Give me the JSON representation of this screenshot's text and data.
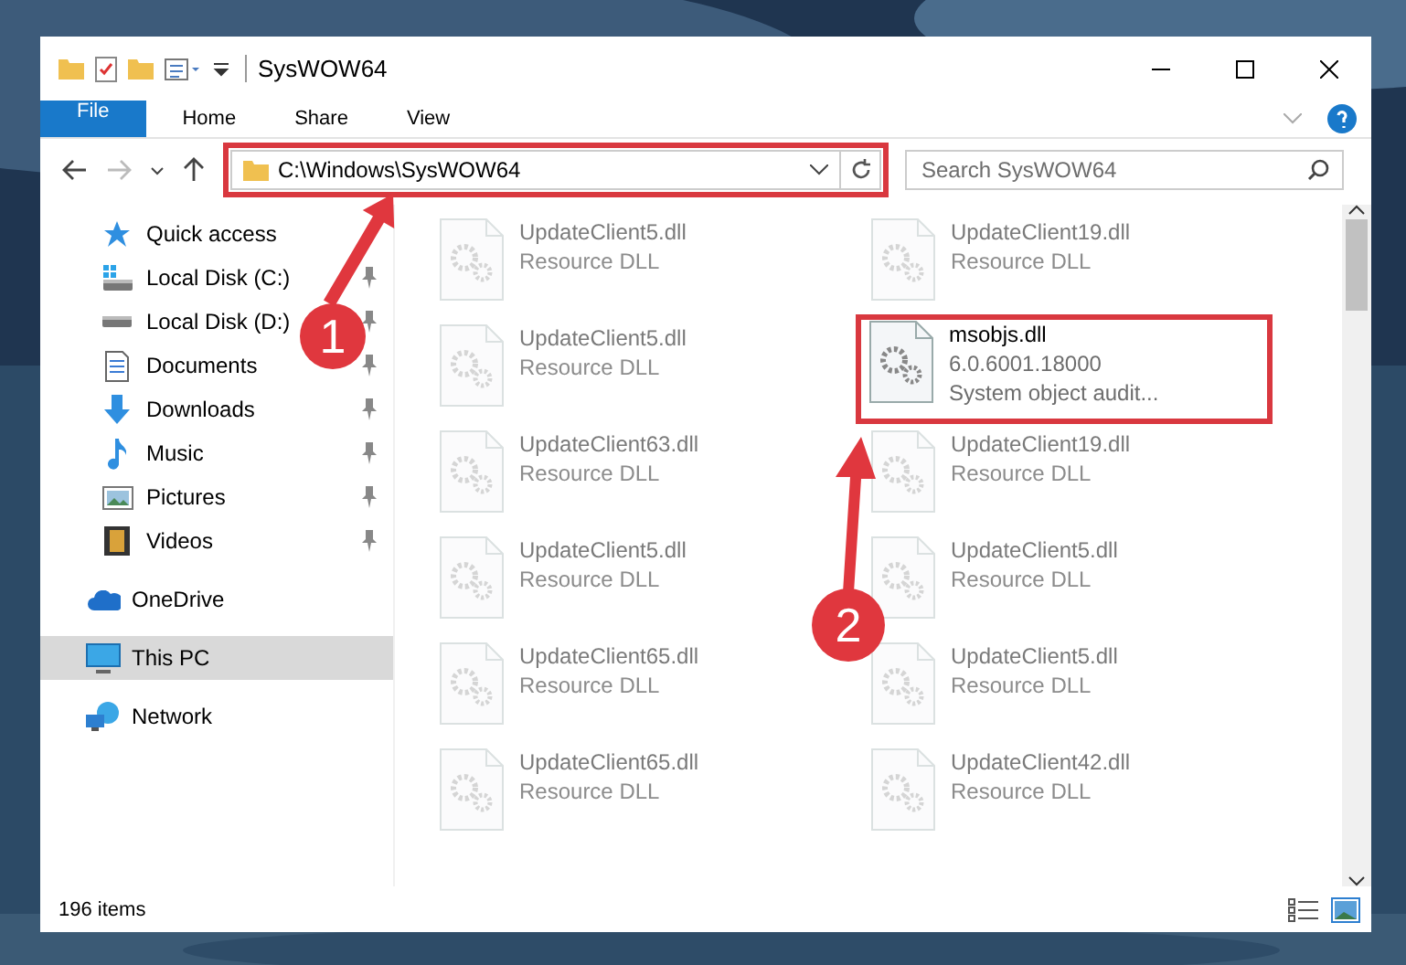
{
  "window": {
    "title": "SysWOW64"
  },
  "ribbon_tabs": [
    {
      "label": "File",
      "kind": "file"
    },
    {
      "label": "Home",
      "kind": "tab"
    },
    {
      "label": "Share",
      "kind": "tab"
    },
    {
      "label": "View",
      "kind": "tab"
    }
  ],
  "address_bar": {
    "path": "C:\\Windows\\SysWOW64"
  },
  "search": {
    "placeholder": "Search SysWOW64"
  },
  "sidebar": {
    "items": [
      {
        "label": "Quick access",
        "kind": "star",
        "pinned": false,
        "selected": false
      },
      {
        "label": "Local Disk (C:)",
        "kind": "drive-win",
        "pinned": true,
        "selected": false
      },
      {
        "label": "Local Disk (D:)",
        "kind": "drive",
        "pinned": true,
        "selected": false
      },
      {
        "label": "Documents",
        "kind": "doc",
        "pinned": true,
        "selected": false
      },
      {
        "label": "Downloads",
        "kind": "download",
        "pinned": true,
        "selected": false
      },
      {
        "label": "Music",
        "kind": "music",
        "pinned": true,
        "selected": false
      },
      {
        "label": "Pictures",
        "kind": "pictures",
        "pinned": true,
        "selected": false
      },
      {
        "label": "Videos",
        "kind": "videos",
        "pinned": true,
        "selected": false
      },
      {
        "label": "OneDrive",
        "kind": "cloud",
        "pinned": false,
        "selected": false
      },
      {
        "label": "This PC",
        "kind": "pc",
        "pinned": false,
        "selected": true
      },
      {
        "label": "Network",
        "kind": "network",
        "pinned": false,
        "selected": false
      }
    ]
  },
  "files": [
    {
      "name": "UpdateClient5.dll",
      "details": [
        "Resource DLL"
      ],
      "faded": true
    },
    {
      "name": "UpdateClient19.dll",
      "details": [
        "Resource DLL"
      ],
      "faded": true
    },
    {
      "name": "UpdateClient5.dll",
      "details": [
        "Resource DLL"
      ],
      "faded": true
    },
    {
      "name": "msobjs.dll",
      "details": [
        "6.0.6001.18000",
        "System object audit..."
      ],
      "faded": false
    },
    {
      "name": "UpdateClient63.dll",
      "details": [
        "Resource DLL"
      ],
      "faded": true
    },
    {
      "name": "UpdateClient19.dll",
      "details": [
        "Resource DLL"
      ],
      "faded": true
    },
    {
      "name": "UpdateClient5.dll",
      "details": [
        "Resource DLL"
      ],
      "faded": true
    },
    {
      "name": "UpdateClient5.dll",
      "details": [
        "Resource DLL"
      ],
      "faded": true
    },
    {
      "name": "UpdateClient65.dll",
      "details": [
        "Resource DLL"
      ],
      "faded": true
    },
    {
      "name": "UpdateClient5.dll",
      "details": [
        "Resource DLL"
      ],
      "faded": true
    },
    {
      "name": "UpdateClient65.dll",
      "details": [
        "Resource DLL"
      ],
      "faded": true
    },
    {
      "name": "UpdateClient42.dll",
      "details": [
        "Resource DLL"
      ],
      "faded": true
    }
  ],
  "status_bar": {
    "item_count": "196 items"
  },
  "annotations": [
    {
      "label": "1"
    },
    {
      "label": "2"
    }
  ]
}
